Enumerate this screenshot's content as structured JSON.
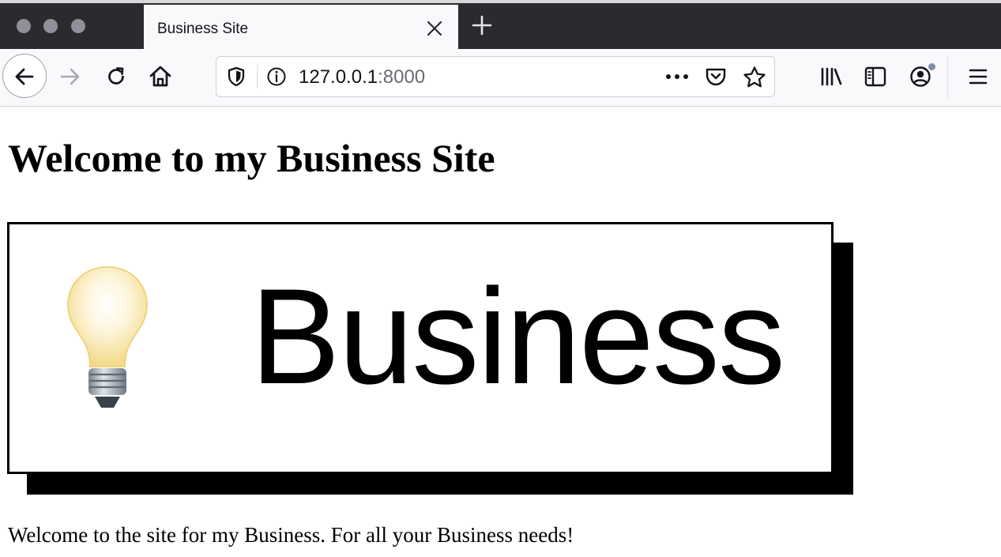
{
  "browser": {
    "tab": {
      "title": "Business Site"
    },
    "address_bar": {
      "host": "127.0.0.1",
      "port": ":8000"
    }
  },
  "page": {
    "heading": "Welcome to my Business Site",
    "banner": {
      "word": "Business"
    },
    "paragraph": "Welcome to the site for my Business. For all your Business needs!"
  },
  "icons": {
    "window": [
      "close-dot",
      "minimize-dot",
      "zoom-dot"
    ],
    "tabs": [
      "close-icon",
      "plus-icon"
    ],
    "navigation": [
      "back-arrow-icon",
      "forward-arrow-icon",
      "reload-icon",
      "home-icon"
    ],
    "address_bar": [
      "shield-icon",
      "info-icon",
      "more-icon",
      "pocket-icon",
      "star-icon"
    ],
    "toolbar": [
      "library-icon",
      "sidebar-icon",
      "account-icon",
      "menu-icon"
    ],
    "banner": [
      "lightbulb-icon"
    ]
  },
  "colors": {
    "tabstrip": "#2b2a2f",
    "toolbar": "#f9f9fb",
    "text": "#15141a",
    "port_text": "#6a6a73",
    "banner_shadow": "#000000",
    "bulb_glass": "#f7e7a6",
    "bulb_base": "#9aa3ad"
  }
}
